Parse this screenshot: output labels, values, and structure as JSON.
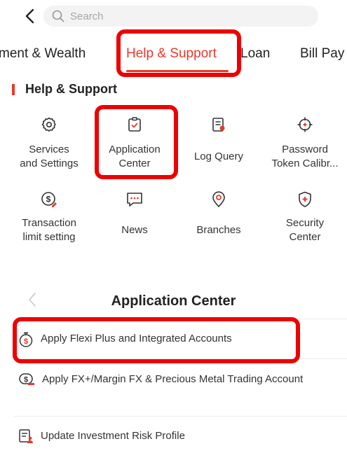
{
  "search": {
    "placeholder": "Search"
  },
  "tabs": [
    {
      "label": "ment & Wealth"
    },
    {
      "label": "Help & Support"
    },
    {
      "label": "Loan"
    },
    {
      "label": "Bill Pay"
    }
  ],
  "section": {
    "title": "Help & Support"
  },
  "grid": [
    {
      "line1": "Services",
      "line2": "and Settings",
      "icon": "gear-icon"
    },
    {
      "line1": "Application",
      "line2": "Center",
      "icon": "clipboard-check-icon"
    },
    {
      "line1": "Log Query",
      "line2": "",
      "icon": "document-search-icon"
    },
    {
      "line1": "Password",
      "line2": "Token Calibr...",
      "icon": "crosshair-icon"
    },
    {
      "line1": "Transaction",
      "line2": "limit setting",
      "icon": "dollar-edit-icon"
    },
    {
      "line1": "News",
      "line2": "",
      "icon": "chat-bubble-icon"
    },
    {
      "line1": "Branches",
      "line2": "",
      "icon": "location-pin-icon"
    },
    {
      "line1": "Security",
      "line2": "Center",
      "icon": "shield-plus-icon"
    }
  ],
  "application_center": {
    "title": "Application Center",
    "items": [
      {
        "label": "Apply Flexi Plus and Integrated Accounts",
        "icon": "stopwatch-dollar-icon"
      },
      {
        "label": "Apply FX+/Margin FX & Precious Metal Trading Account",
        "icon": "dollar-card-icon"
      },
      {
        "label": "Update Investment Risk Profile",
        "icon": "document-user-icon"
      }
    ]
  },
  "colors": {
    "accent": "#e8392b",
    "highlight": "#ee0000"
  }
}
